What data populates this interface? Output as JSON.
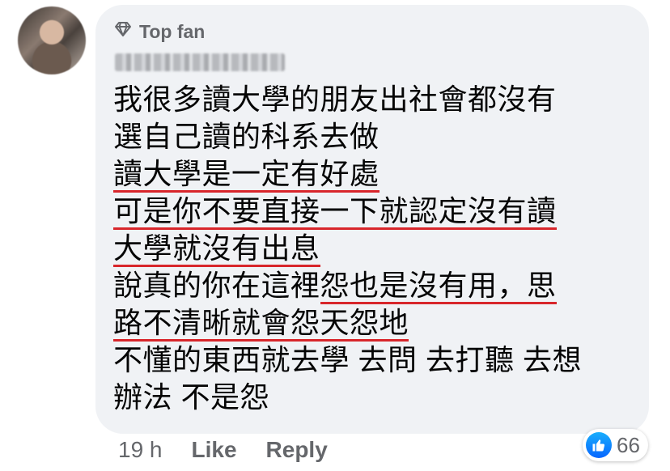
{
  "badge": {
    "label": "Top fan"
  },
  "comment": {
    "lines": [
      {
        "segments": [
          {
            "text": "我很多讀大學的朋友出社會都沒有",
            "underline": false
          }
        ]
      },
      {
        "segments": [
          {
            "text": "選自己讀的科系去做",
            "underline": false
          }
        ]
      },
      {
        "segments": [
          {
            "text": "讀大學是一定有好處",
            "underline": true
          }
        ]
      },
      {
        "segments": [
          {
            "text": "可是你不要直接一下就認定沒有讀",
            "underline": true
          }
        ]
      },
      {
        "segments": [
          {
            "text": "大學就沒有出息",
            "underline": true
          }
        ]
      },
      {
        "segments": [
          {
            "text": "說真的你在這裡",
            "underline": false
          },
          {
            "text": "怨也是沒有用，思",
            "underline": true
          }
        ]
      },
      {
        "segments": [
          {
            "text": "路不清晰就會怨天怨地",
            "underline": true
          }
        ]
      },
      {
        "segments": [
          {
            "text": "不懂的東西就去學 去問 去打聽 去想",
            "underline": false
          }
        ]
      },
      {
        "segments": [
          {
            "text": "辦法 不是怨",
            "underline": false
          }
        ]
      }
    ]
  },
  "meta": {
    "time": "19 h",
    "like_label": "Like",
    "reply_label": "Reply"
  },
  "reactions": {
    "icon": "thumbs-up-icon",
    "count": "66"
  },
  "colors": {
    "bubble": "#f0f2f5",
    "underline": "#d8262b",
    "meta_text": "#65676b",
    "like_blue": "#0866ff"
  }
}
